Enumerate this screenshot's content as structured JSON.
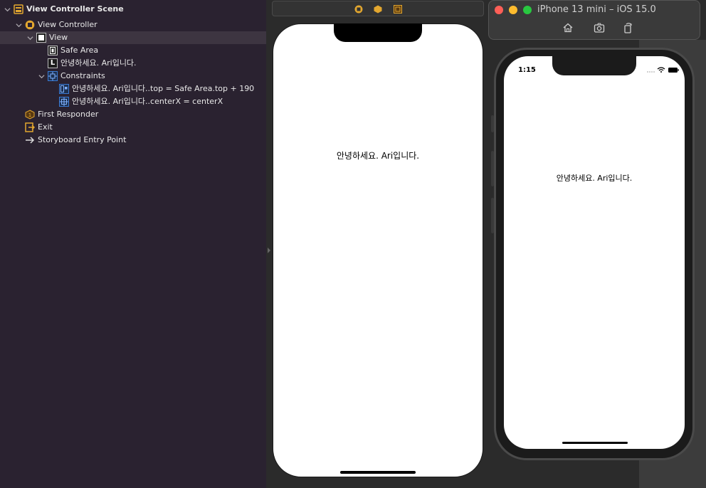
{
  "outline": {
    "scene_title": "View Controller Scene",
    "view_controller": "View Controller",
    "view": "View",
    "safe_area": "Safe Area",
    "label": "안녕하세요. Ari입니다.",
    "constraints": "Constraints",
    "constraint_top": "안녕하세요. Ari입니다..top = Safe Area.top + 190",
    "constraint_centerx": "안녕하세요. Ari입니다..centerX = centerX",
    "first_responder": "First Responder",
    "exit": "Exit",
    "entry_point": "Storyboard Entry Point",
    "label_icon_letter": "L"
  },
  "canvas": {
    "label_text": "안녕하세요. Ari입니다."
  },
  "simulator": {
    "title": "iPhone 13 mini – iOS 15.0",
    "time": "1:15",
    "label_text": "안녕하세요. Ari입니다."
  },
  "colors": {
    "outline_bg": "#2a2230",
    "selection": "#3d3541",
    "accent_yellow": "#e3a72f",
    "accent_blue": "#3a7bd5",
    "traffic_red": "#ff5f57",
    "traffic_yellow": "#febc2e",
    "traffic_green": "#28c840"
  }
}
